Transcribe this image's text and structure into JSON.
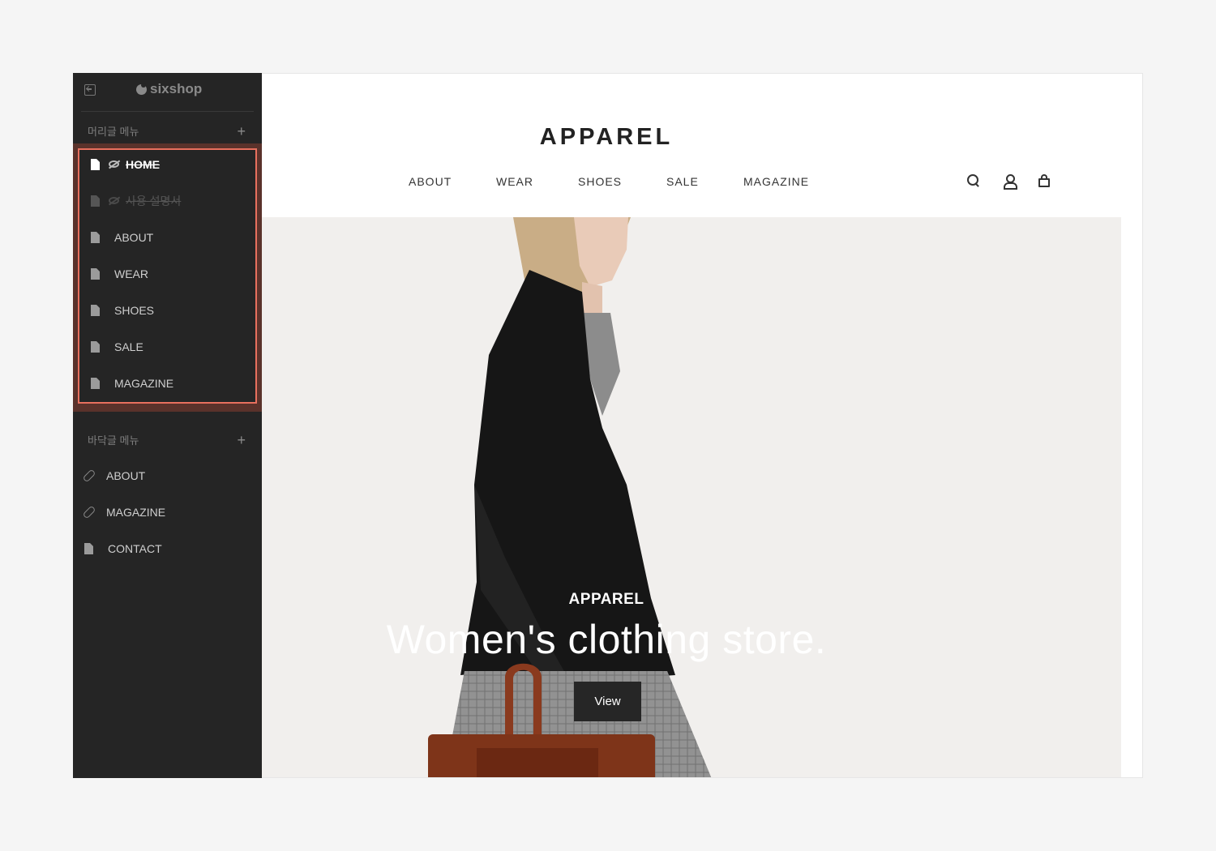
{
  "sidebar": {
    "brand": "sixshop",
    "header_menu": {
      "title": "머리글 메뉴",
      "add": "+",
      "items": [
        {
          "label": "HOME",
          "icon": "page-icon",
          "state": "hidden-home"
        },
        {
          "label": "사용 설명서",
          "icon": "page-icon",
          "state": "hidden"
        },
        {
          "label": "ABOUT",
          "icon": "page-icon"
        },
        {
          "label": "WEAR",
          "icon": "page-icon"
        },
        {
          "label": "SHOES",
          "icon": "page-icon"
        },
        {
          "label": "SALE",
          "icon": "page-icon"
        },
        {
          "label": "MAGAZINE",
          "icon": "page-icon"
        }
      ]
    },
    "footer_menu": {
      "title": "바닥글 메뉴",
      "add": "+",
      "items": [
        {
          "label": "ABOUT",
          "icon": "link-icon"
        },
        {
          "label": "MAGAZINE",
          "icon": "link-icon"
        },
        {
          "label": "CONTACT",
          "icon": "page-icon"
        }
      ]
    },
    "highlight_color": "#e8705e"
  },
  "site": {
    "logo": "APPAREL",
    "nav": [
      "ABOUT",
      "WEAR",
      "SHOES",
      "SALE",
      "MAGAZINE"
    ],
    "icons": [
      "search-icon",
      "user-icon",
      "bag-icon"
    ]
  },
  "hero": {
    "subtitle": "APPAREL",
    "title": "Women's clothing store.",
    "button": "View"
  }
}
